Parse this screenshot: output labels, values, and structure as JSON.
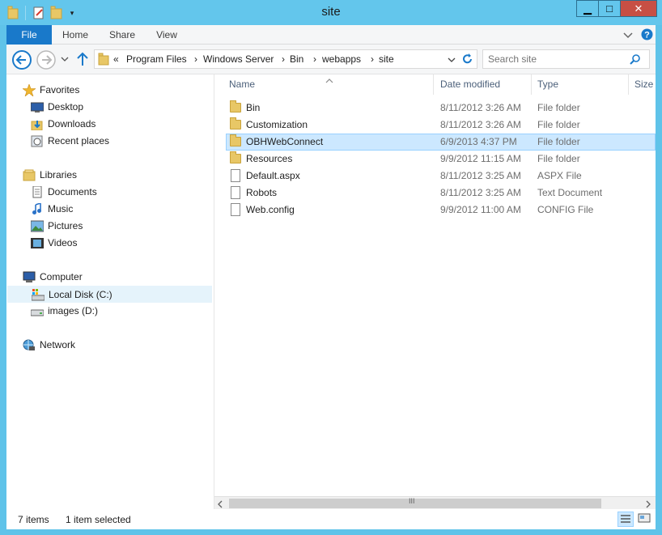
{
  "window": {
    "title": "site",
    "minimize_glyph": "▁",
    "maximize_glyph": "□",
    "close_glyph": "✕"
  },
  "ribbon": {
    "tabs": [
      "File",
      "Home",
      "Share",
      "View"
    ]
  },
  "address": {
    "prefix": "«",
    "crumbs": [
      "Program Files",
      "Windows Server",
      "Bin",
      "webapps",
      "site"
    ],
    "separator": "›",
    "search_placeholder": "Search site"
  },
  "nav": {
    "favorites": {
      "label": "Favorites",
      "items": [
        "Desktop",
        "Downloads",
        "Recent places"
      ]
    },
    "libraries": {
      "label": "Libraries",
      "items": [
        "Documents",
        "Music",
        "Pictures",
        "Videos"
      ]
    },
    "computer": {
      "label": "Computer",
      "items": [
        "Local Disk (C:)",
        "images (D:)"
      ]
    },
    "network": {
      "label": "Network"
    }
  },
  "columns": [
    "Name",
    "Date modified",
    "Type",
    "Size"
  ],
  "files": [
    {
      "name": "Bin",
      "date": "8/11/2012 3:26 AM",
      "type": "File folder",
      "kind": "folder"
    },
    {
      "name": "Customization",
      "date": "8/11/2012 3:26 AM",
      "type": "File folder",
      "kind": "folder"
    },
    {
      "name": "OBHWebConnect",
      "date": "6/9/2013 4:37 PM",
      "type": "File folder",
      "kind": "folder"
    },
    {
      "name": "Resources",
      "date": "9/9/2012 11:15 AM",
      "type": "File folder",
      "kind": "folder"
    },
    {
      "name": "Default.aspx",
      "date": "8/11/2012 3:25 AM",
      "type": "ASPX File",
      "kind": "file"
    },
    {
      "name": "Robots",
      "date": "8/11/2012 3:25 AM",
      "type": "Text Document",
      "kind": "file"
    },
    {
      "name": "Web.config",
      "date": "9/9/2012 11:00 AM",
      "type": "CONFIG File",
      "kind": "file"
    }
  ],
  "status": {
    "count": "7 items",
    "selected": "1 item selected"
  },
  "scroll_grip": "III",
  "colors": {
    "accent": "#1979ca",
    "selection": "#cce8ff",
    "titlebar": "#63c6ec"
  }
}
